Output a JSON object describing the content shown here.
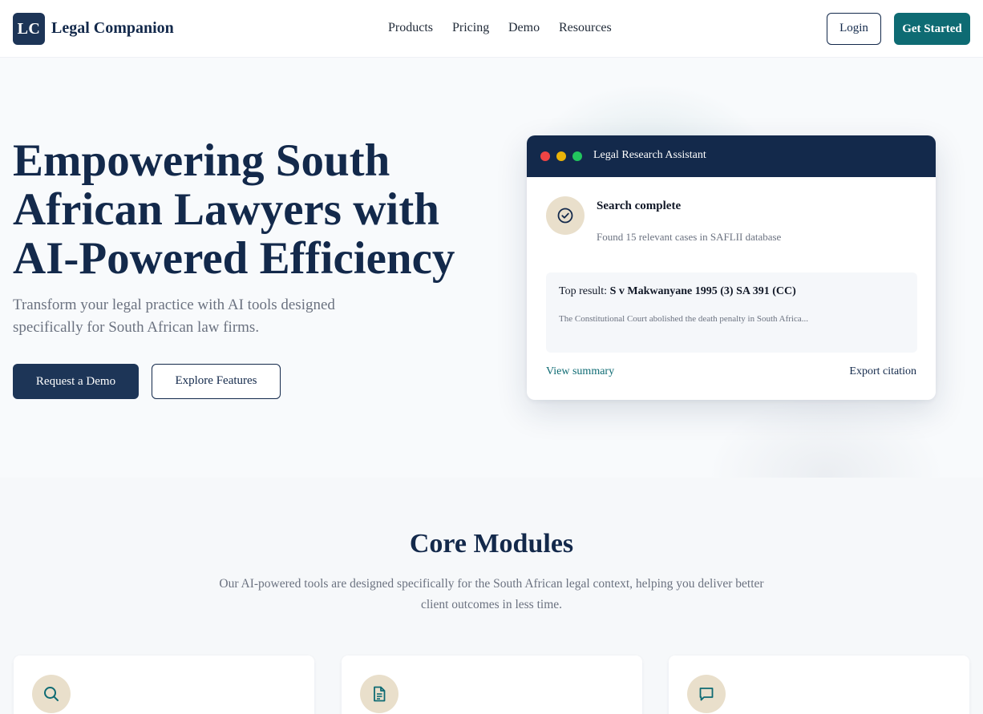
{
  "header": {
    "logo_mark": "LC",
    "logo_text": "Legal Companion",
    "nav": [
      "Products",
      "Pricing",
      "Demo",
      "Resources"
    ],
    "login_label": "Login",
    "get_started_label": "Get Started"
  },
  "hero": {
    "title": "Empowering South African Lawyers with AI-Powered Efficiency",
    "subtitle": "Transform your legal practice with AI tools designed specifically for South African law firms.",
    "primary_button": "Request a Demo",
    "secondary_button": "Explore Features"
  },
  "assistant_card": {
    "title": "Legal Research Assistant",
    "window_dots": [
      "#ef4444",
      "#eab308",
      "#22c55e"
    ],
    "status_icon": "check-circle-icon",
    "status_title": "Search complete",
    "status_desc": "Found 15 relevant cases in SAFLII database",
    "result_label": "Top result:",
    "result_case": "S v Makwanyane 1995 (3) SA 391 (CC)",
    "result_text": "The Constitutional Court abolished the death penalty in South Africa...",
    "view_summary": "View summary",
    "export_citation": "Export citation"
  },
  "modules": {
    "title": "Core Modules",
    "description": "Our AI-powered tools are designed specifically for the South African legal context, helping you deliver better client outcomes in less time.",
    "cards": [
      {
        "icon": "search-icon"
      },
      {
        "icon": "document-icon"
      },
      {
        "icon": "chat-icon"
      }
    ]
  },
  "colors": {
    "navy": "#13294b",
    "teal": "#0e6b73",
    "beige": "#e9dfcb"
  }
}
